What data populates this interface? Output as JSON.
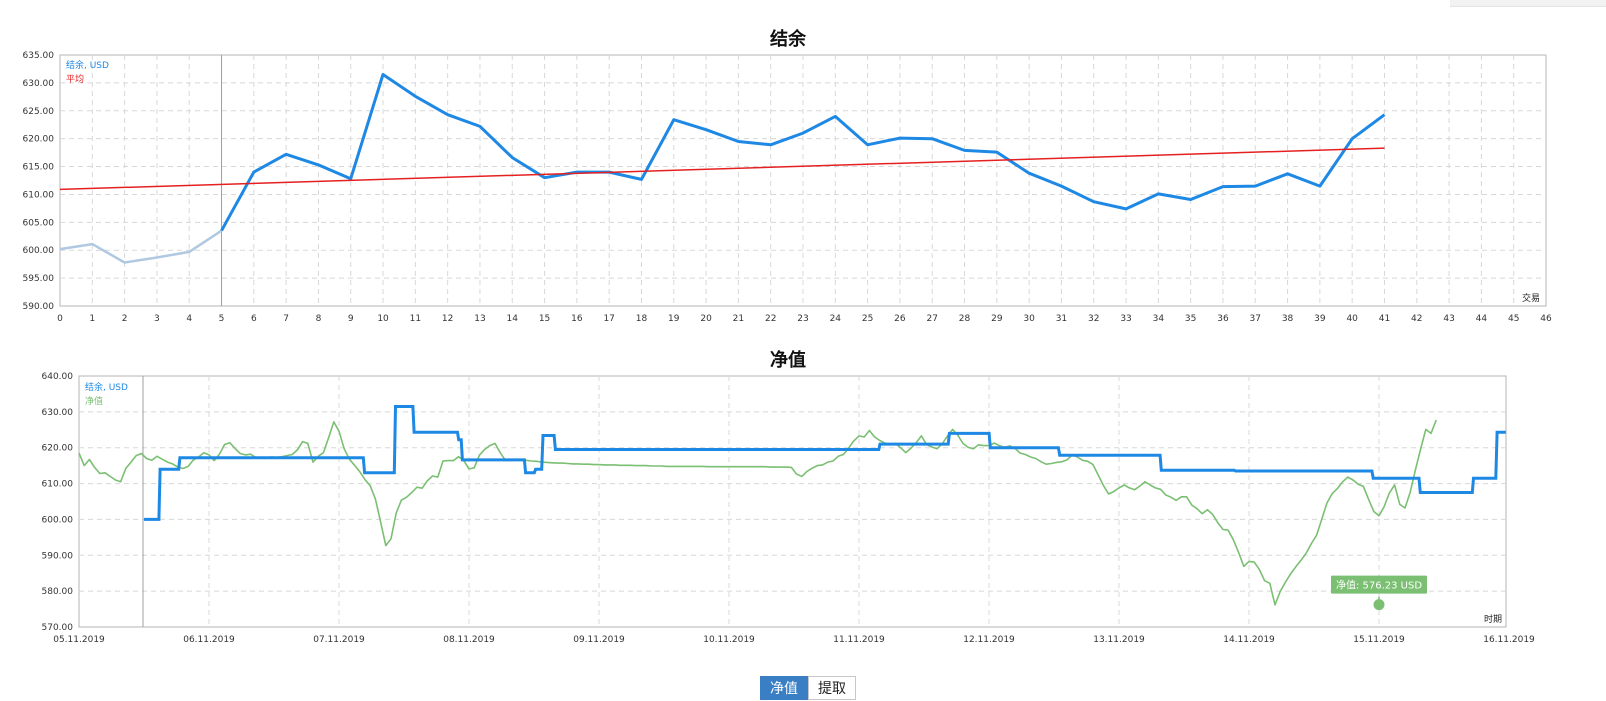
{
  "charts": {
    "balance_title": "结余",
    "equity_title": "净值"
  },
  "tabs": {
    "equity_label": "净值",
    "withdraw_label": "提取"
  },
  "chart_data": [
    {
      "type": "line",
      "title": "结余",
      "xlabel": "交易",
      "xlim": [
        0,
        46
      ],
      "ylim": [
        590,
        635
      ],
      "yticks": [
        "590.00",
        "595.00",
        "600.00",
        "605.00",
        "610.00",
        "615.00",
        "620.00",
        "625.00",
        "630.00",
        "635.00"
      ],
      "xticks": [
        "0",
        "1",
        "2",
        "3",
        "4",
        "5",
        "6",
        "7",
        "8",
        "9",
        "10",
        "11",
        "12",
        "13",
        "14",
        "15",
        "16",
        "17",
        "18",
        "19",
        "20",
        "21",
        "22",
        "23",
        "24",
        "25",
        "26",
        "27",
        "28",
        "29",
        "30",
        "31",
        "32",
        "33",
        "34",
        "35",
        "36",
        "37",
        "38",
        "39",
        "40",
        "41",
        "42",
        "43",
        "44",
        "45",
        "46"
      ],
      "grid": true,
      "legend_position": "top-left",
      "vertical_marker_x": 5,
      "series": [
        {
          "name": "结余, USD",
          "color": "#1e88e5",
          "faded_color": "#b0c8e2",
          "faded_until_x": 5,
          "x": [
            0,
            1,
            2,
            3,
            4,
            5,
            6,
            7,
            8,
            9,
            10,
            11,
            12,
            13,
            14,
            15,
            16,
            17,
            18,
            19,
            20,
            21,
            22,
            23,
            24,
            25,
            26,
            27,
            28,
            29,
            30,
            31,
            32,
            33,
            34,
            35,
            36,
            37,
            38,
            39,
            40,
            41
          ],
          "y": [
            600.2,
            601.1,
            597.8,
            598.7,
            599.7,
            603.5,
            614.0,
            617.2,
            615.3,
            612.8,
            631.5,
            627.6,
            624.3,
            622.2,
            616.6,
            613.0,
            614.0,
            614.0,
            612.7,
            623.4,
            621.6,
            619.5,
            618.9,
            621.0,
            624.0,
            618.9,
            620.1,
            620.0,
            617.9,
            617.6,
            613.8,
            611.5,
            608.7,
            607.4,
            610.1,
            609.1,
            611.4,
            611.5,
            613.7,
            611.5,
            620.0,
            624.3
          ]
        },
        {
          "name": "平均",
          "color": "#e52020",
          "x": [
            0,
            41
          ],
          "y": [
            610.9,
            618.3
          ]
        }
      ]
    },
    {
      "type": "line",
      "title": "净值",
      "xlabel": "时期",
      "ylim": [
        570,
        640
      ],
      "yticks": [
        "570.00",
        "580.00",
        "590.00",
        "600.00",
        "610.00",
        "620.00",
        "630.00",
        "640.00"
      ],
      "date_ticks": [
        "05.11.2019",
        "06.11.2019",
        "07.11.2019",
        "08.11.2019",
        "09.11.2019",
        "10.11.2019",
        "11.11.2019",
        "12.11.2019",
        "13.11.2019",
        "14.11.2019",
        "15.11.2019",
        "16.11.2019"
      ],
      "grid": true,
      "legend_position": "top-left",
      "tooltip": {
        "text": "净值: 576.23 USD",
        "date": "15.11.2019",
        "day_offset": 10.0,
        "value": 576.23
      },
      "series": [
        {
          "name": "结余, USD",
          "color": "#1e88e5",
          "style": "step",
          "x_days": [
            0.0,
            0.12,
            0.13,
            0.28,
            0.29,
            1.77,
            1.78,
            2.02,
            2.03,
            2.17,
            2.18,
            2.53,
            2.54,
            2.56,
            2.57,
            3.07,
            3.08,
            3.15,
            3.16,
            3.21,
            3.22,
            3.31,
            3.32,
            5.93,
            5.94,
            6.49,
            6.5,
            6.82,
            6.83,
            7.38,
            7.39,
            8.2,
            8.21,
            8.8,
            8.81,
            9.91,
            9.92,
            10.29,
            10.3,
            10.72,
            10.73,
            10.91,
            10.92,
            10.98,
            10.99
          ],
          "y": [
            600.0,
            600.0,
            614.0,
            614.0,
            617.2,
            617.2,
            613.0,
            613.0,
            631.5,
            631.5,
            624.3,
            624.3,
            622.2,
            622.2,
            616.6,
            616.6,
            613.0,
            613.0,
            614.0,
            614.0,
            623.4,
            623.4,
            619.5,
            619.5,
            621.0,
            621.0,
            624.0,
            624.0,
            620.0,
            620.0,
            617.9,
            617.9,
            613.7,
            613.7,
            613.5,
            613.5,
            611.5,
            611.5,
            607.5,
            607.5,
            611.5,
            611.5,
            624.3,
            624.3,
            624.3
          ]
        },
        {
          "name": "净值",
          "color": "#7abf72",
          "x_days": [
            0.0,
            0.04,
            0.08,
            0.12,
            0.16,
            0.2,
            0.24,
            0.28,
            0.32,
            0.36,
            0.4,
            0.44,
            0.48,
            0.52,
            0.56,
            0.6,
            0.64,
            0.68,
            0.72,
            0.76,
            0.8,
            0.84,
            0.88,
            0.92,
            0.96,
            1.0,
            1.04,
            1.08,
            1.12,
            1.16,
            1.2,
            1.24,
            1.28,
            1.32,
            1.36,
            1.4,
            1.44,
            1.48,
            1.52,
            1.56,
            1.6,
            1.64,
            1.68,
            1.72,
            1.76,
            1.8,
            1.84,
            1.88,
            1.92,
            1.96,
            2.0,
            2.04,
            2.08,
            2.12,
            2.16,
            2.2,
            2.24,
            2.28,
            2.32,
            2.36,
            2.4,
            2.44,
            2.48,
            2.52,
            2.56,
            2.6,
            2.64,
            2.68,
            2.72,
            2.76,
            2.8,
            2.84,
            2.88,
            2.92,
            2.96,
            3.0,
            3.04,
            3.08,
            3.12,
            3.16,
            3.2,
            3.24,
            3.28,
            3.32,
            3.36,
            3.4,
            3.44,
            3.48,
            3.52,
            3.56,
            3.6,
            3.64,
            3.68,
            3.72,
            3.76,
            3.8,
            3.84,
            3.88,
            3.92,
            3.96,
            4.0,
            4.04,
            4.08,
            4.12,
            4.16,
            4.2,
            4.24,
            4.28,
            4.32,
            4.36,
            4.4,
            4.44,
            4.48,
            4.52,
            4.56,
            4.6,
            4.64,
            4.68,
            4.72,
            4.76,
            4.8,
            4.84,
            4.88,
            4.92,
            4.96,
            5.0,
            5.04,
            5.08,
            5.12,
            5.16,
            5.2,
            5.24,
            5.28,
            5.32,
            5.36,
            5.4,
            5.44,
            5.48,
            5.52,
            5.56,
            5.6,
            5.64,
            5.68,
            5.72,
            5.76,
            5.8,
            5.84,
            5.88,
            5.92,
            5.96,
            6.0,
            6.04,
            6.08,
            6.12,
            6.16,
            6.2,
            6.24,
            6.28,
            6.32,
            6.36,
            6.4,
            6.44,
            6.48,
            6.52,
            6.56,
            6.6,
            6.64,
            6.68,
            6.72,
            6.76,
            6.8,
            6.84,
            6.88,
            6.92,
            6.96,
            7.0,
            7.04,
            7.08,
            7.12,
            7.16,
            7.2,
            7.24,
            7.28,
            7.32,
            7.36,
            7.4,
            7.44,
            7.48,
            7.52,
            7.56,
            7.6,
            7.64,
            7.68,
            7.72,
            7.76,
            7.8,
            7.84,
            7.88,
            7.92,
            7.96,
            8.0,
            8.04,
            8.08,
            8.12,
            8.16,
            8.2,
            8.24,
            8.28,
            8.32,
            8.36,
            8.4,
            8.44,
            8.48,
            8.52,
            8.56,
            8.6,
            8.64,
            8.68,
            8.72,
            8.76,
            8.8,
            8.84,
            8.88,
            8.92,
            8.96,
            9.0,
            9.04,
            9.08,
            9.12,
            9.16,
            9.2,
            9.24,
            9.28,
            9.32,
            9.36,
            9.4,
            9.44,
            9.48,
            9.52,
            9.56,
            9.6,
            9.64,
            9.68,
            9.72,
            9.76,
            9.8,
            9.84,
            9.88,
            9.92,
            9.96,
            10.0,
            10.04,
            10.08,
            10.12,
            10.16,
            10.2,
            10.24,
            10.28,
            10.32,
            10.36,
            10.4,
            10.44,
            10.48,
            10.52,
            10.56,
            10.6,
            10.64,
            10.68,
            10.72,
            10.76,
            10.8,
            10.84,
            10.88,
            10.92,
            10.96,
            11.0
          ],
          "y": [
            618.5,
            615.0,
            616.7,
            614.5,
            612.8,
            613.0,
            612.0,
            611.0,
            610.5,
            614.2,
            616.0,
            617.8,
            618.4,
            617.0,
            616.5,
            617.6,
            616.8,
            616.0,
            615.5,
            614.6,
            614.2,
            614.8,
            616.6,
            617.4,
            618.6,
            618.0,
            616.4,
            618.2,
            620.9,
            621.4,
            619.8,
            618.4,
            618.0,
            618.2,
            617.3,
            617.2,
            617.2,
            617.4,
            617.3,
            617.5,
            617.8,
            618.1,
            619.4,
            621.7,
            621.2,
            616.0,
            617.6,
            618.6,
            622.8,
            627.2,
            624.6,
            619.7,
            616.8,
            615.1,
            613.3,
            611.1,
            609.4,
            605.7,
            599.3,
            592.7,
            594.6,
            601.8,
            605.4,
            606.2,
            607.5,
            609.0,
            608.7,
            610.8,
            612.1,
            611.8,
            616.3,
            616.4,
            616.4,
            617.5,
            616.4,
            614.1,
            614.4,
            617.9,
            619.5,
            620.6,
            621.2,
            618.6,
            616.5,
            616.4,
            616.6,
            616.5,
            616.5,
            616.3,
            616.2,
            616.0,
            615.9,
            615.8,
            615.7,
            615.7,
            615.6,
            615.5,
            615.5,
            615.4,
            615.4,
            615.3,
            615.3,
            615.2,
            615.2,
            615.2,
            615.1,
            615.1,
            615.1,
            615.0,
            615.0,
            615.0,
            614.9,
            614.9,
            614.9,
            614.8,
            614.8,
            614.8,
            614.8,
            614.8,
            614.8,
            614.8,
            614.8,
            614.7,
            614.7,
            614.7,
            614.7,
            614.7,
            614.7,
            614.7,
            614.7,
            614.7,
            614.7,
            614.7,
            614.7,
            614.6,
            614.6,
            614.6,
            614.6,
            614.5,
            612.6,
            612.0,
            613.4,
            614.3,
            615.0,
            615.2,
            616.0,
            616.3,
            617.6,
            618.1,
            619.9,
            621.9,
            623.3,
            623.0,
            624.8,
            623.0,
            622.0,
            621.3,
            620.8,
            621.2,
            620.0,
            618.6,
            619.9,
            621.4,
            623.3,
            620.9,
            620.2,
            619.7,
            621.1,
            623.2,
            625.1,
            623.5,
            621.2,
            620.1,
            619.7,
            620.8,
            620.6,
            620.6,
            621.3,
            620.6,
            620.1,
            620.5,
            619.8,
            618.5,
            618.1,
            617.4,
            617.0,
            616.1,
            615.4,
            615.6,
            615.9,
            616.1,
            616.6,
            618.0,
            617.4,
            616.5,
            616.2,
            615.3,
            612.4,
            609.5,
            607.1,
            607.8,
            608.8,
            609.6,
            608.8,
            608.3,
            609.3,
            610.5,
            609.6,
            608.8,
            608.4,
            606.8,
            606.2,
            605.3,
            606.3,
            606.3,
            604.0,
            603.0,
            601.6,
            602.7,
            601.4,
            599.1,
            597.2,
            597.0,
            594.3,
            590.8,
            586.9,
            588.3,
            588.1,
            586.0,
            582.9,
            582.2,
            576.2,
            579.9,
            582.5,
            584.8,
            586.8,
            588.6,
            590.6,
            593.3,
            595.6,
            600.1,
            604.6,
            607.2,
            608.6,
            610.5,
            611.8,
            611.0,
            609.8,
            609.2,
            605.6,
            602.2,
            601.0,
            603.6,
            607.4,
            609.6,
            604.2,
            603.2,
            607.6,
            613.8,
            619.6,
            625.1,
            624.0,
            627.7
          ]
        }
      ]
    }
  ]
}
